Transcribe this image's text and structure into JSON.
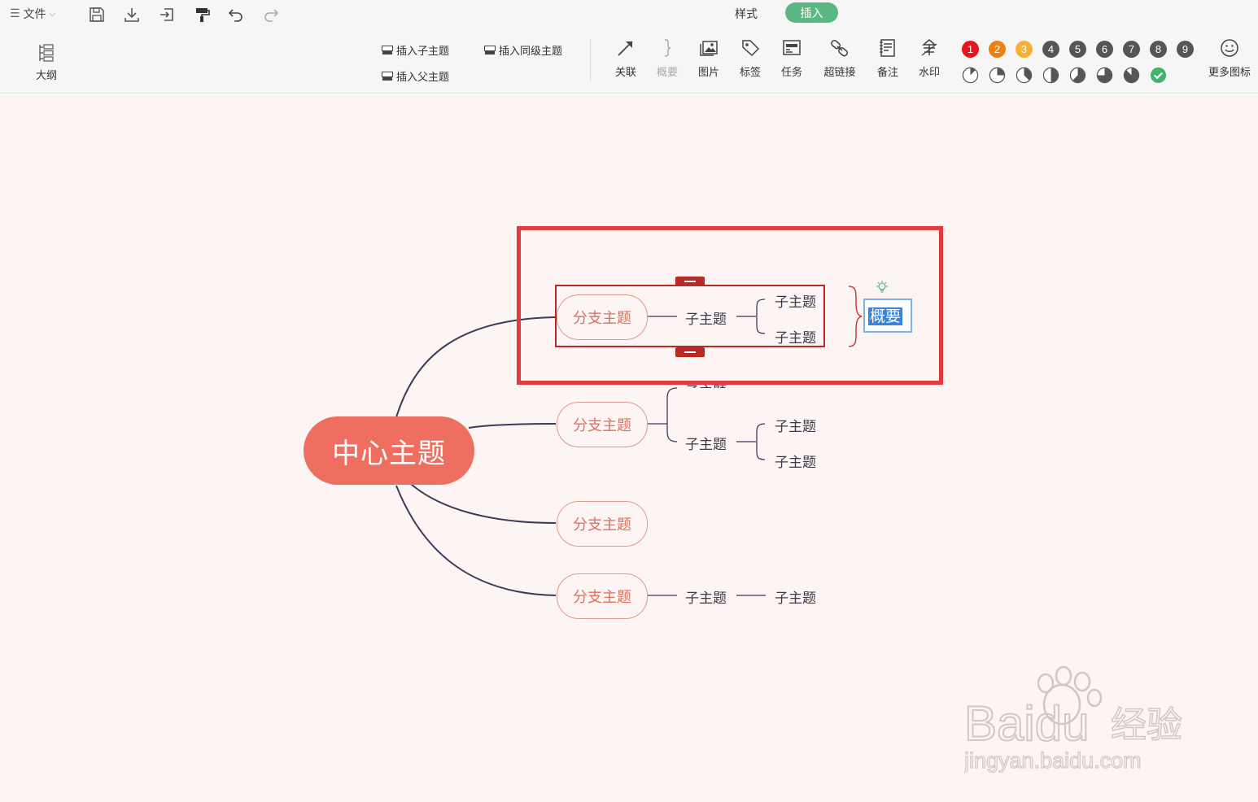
{
  "menu": {
    "file_label": "文件",
    "quick_icons": [
      "save-icon",
      "download-icon",
      "export-icon",
      "format-painter-icon",
      "undo-icon",
      "redo-icon"
    ]
  },
  "tabs": [
    {
      "label": "样式",
      "active": false
    },
    {
      "label": "插入",
      "active": true,
      "color": "#5cb882"
    }
  ],
  "outline": {
    "label": "大纲"
  },
  "insert_buttons": {
    "child": "插入子主题",
    "sibling": "插入同级主题",
    "parent": "插入父主题"
  },
  "tools": [
    {
      "label": "关联",
      "icon": "relation-arrow-icon",
      "disabled": false
    },
    {
      "label": "概要",
      "icon": "summary-brace-icon",
      "disabled": true
    },
    {
      "label": "图片",
      "icon": "image-icon",
      "disabled": false
    },
    {
      "label": "标签",
      "icon": "tag-icon",
      "disabled": false
    },
    {
      "label": "任务",
      "icon": "task-icon",
      "disabled": false
    },
    {
      "label": "超链接",
      "icon": "hyperlink-icon",
      "disabled": false
    },
    {
      "label": "备注",
      "icon": "note-icon",
      "disabled": false
    },
    {
      "label": "水印",
      "icon": "watermark-icon",
      "disabled": false
    }
  ],
  "priority_icons": [
    {
      "label": "1",
      "color": "#e4161c"
    },
    {
      "label": "2",
      "color": "#f07f12"
    },
    {
      "label": "3",
      "color": "#f5b035"
    },
    {
      "label": "4",
      "color": "#555555"
    },
    {
      "label": "5",
      "color": "#555555"
    },
    {
      "label": "6",
      "color": "#555555"
    },
    {
      "label": "7",
      "color": "#555555"
    },
    {
      "label": "8",
      "color": "#555555"
    },
    {
      "label": "9",
      "color": "#555555"
    }
  ],
  "progress_icons": [
    0.125,
    0.25,
    0.375,
    0.5,
    0.625,
    0.75,
    0.875,
    1.0
  ],
  "progress_done_color": "#41b36b",
  "more_icons": {
    "label": "更多图标"
  },
  "mindmap": {
    "central": "中心主题",
    "central_color": "#ee6f60",
    "line_color": "#3d3b5c",
    "branch_1": {
      "label": "分支主题",
      "sub": "子主题",
      "subsub": [
        "子主题",
        "子主题"
      ]
    },
    "branch_2": {
      "label": "分支主题",
      "sub": [
        "子主题",
        "子主题"
      ],
      "subsub": [
        "子主题",
        "子主题"
      ]
    },
    "branch_3": {
      "label": "分支主题"
    },
    "branch_4": {
      "label": "分支主题",
      "sub": "子主题",
      "subsub": "子主题"
    },
    "summary_text": "概要",
    "highlight_color": "#e33a3f",
    "selection_color": "#b82a25"
  },
  "watermark": {
    "brand": "Baidu",
    "cn": "经验",
    "url": "jingyan.baidu.com"
  }
}
